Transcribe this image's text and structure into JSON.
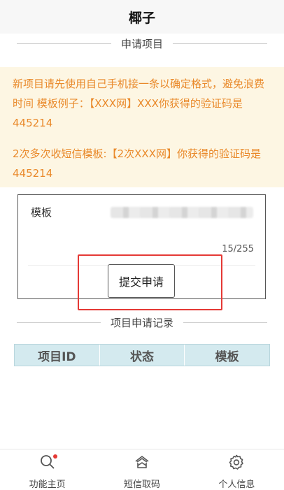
{
  "header": {
    "title": "椰子"
  },
  "apply_section": {
    "title": "申请项目"
  },
  "notice": {
    "line1": "新项目请先使用自己手机接一条以确定格式，避免浪费时间 模板例子：【XXX网】XXX你获得的验证码是445214",
    "line2": "2次多次收短信模板:【2次XXX网】你获得的验证码是445214"
  },
  "form": {
    "template_label": "模板",
    "counter": "15/255",
    "submit_label": "提交申请"
  },
  "records_section": {
    "title": "项目申请记录"
  },
  "table": {
    "columns": [
      "项目ID",
      "状态",
      "模板"
    ]
  },
  "tabbar": {
    "items": [
      {
        "label": "功能主页",
        "icon": "search-icon"
      },
      {
        "label": "短信取码",
        "icon": "home-icon"
      },
      {
        "label": "个人信息",
        "icon": "gear-icon"
      }
    ]
  },
  "colors": {
    "notice_text": "#e9892a",
    "notice_bg": "#fdf6e3",
    "highlight": "#e53935",
    "table_header_bg": "#d4eaef"
  }
}
